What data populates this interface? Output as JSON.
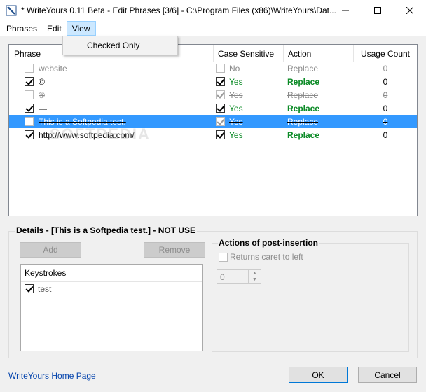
{
  "window": {
    "title": "* WriteYours 0.11 Beta - Edit Phrases [3/6] - C:\\Program Files (x86)\\WriteYours\\Dat..."
  },
  "menu": {
    "items": [
      "Phrases",
      "Edit",
      "View"
    ],
    "view_dropdown": [
      "Checked Only"
    ]
  },
  "list": {
    "columns": [
      "Phrase",
      "Case Sensitive",
      "Action",
      "Usage Count"
    ],
    "rows": [
      {
        "phrase": "website",
        "checked": false,
        "case": "No",
        "case_checked": false,
        "action": "Replace",
        "count": "0",
        "enabled": false,
        "selected": false
      },
      {
        "phrase": "©",
        "checked": true,
        "case": "Yes",
        "case_checked": true,
        "action": "Replace",
        "count": "0",
        "enabled": true,
        "selected": false
      },
      {
        "phrase": "®",
        "checked": false,
        "case": "Yes",
        "case_checked": true,
        "action": "Replace",
        "count": "0",
        "enabled": false,
        "selected": false
      },
      {
        "phrase": "—",
        "checked": true,
        "case": "Yes",
        "case_checked": true,
        "action": "Replace",
        "count": "0",
        "enabled": true,
        "selected": false
      },
      {
        "phrase": "This is a Softpedia test.",
        "checked": false,
        "case": "Yes",
        "case_checked": true,
        "action": "Replace",
        "count": "0",
        "enabled": false,
        "selected": true
      },
      {
        "phrase": "http://www.softpedia.com/",
        "checked": true,
        "case": "Yes",
        "case_checked": true,
        "action": "Replace",
        "count": "0",
        "enabled": true,
        "selected": false
      }
    ]
  },
  "watermark": "SOFTPEDIA",
  "details": {
    "title": "Details - [This is a Softpedia test.] - NOT USE",
    "add_label": "Add",
    "remove_label": "Remove",
    "keystrokes_header": "Keystrokes",
    "keystrokes": [
      {
        "label": "test",
        "checked": true
      }
    ],
    "post_title": "Actions of post-insertion",
    "returns_caret_label": "Returns caret to left",
    "spin_value": "0"
  },
  "footer": {
    "home_link": "WriteYours Home Page",
    "ok_label": "OK",
    "cancel_label": "Cancel"
  }
}
